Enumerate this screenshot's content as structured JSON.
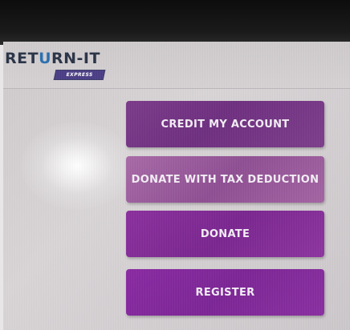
{
  "brand": {
    "logo_prefix": "RET",
    "logo_u": "U",
    "logo_suffix": "RN-IT",
    "badge": "EXPRESS",
    "colors": {
      "text": "#2a3346",
      "u_accent": "#2b6fae",
      "badge": "#4b3e86"
    }
  },
  "menu": {
    "credit_label": "CREDIT MY ACCOUNT",
    "donate_tax_label": "DONATE WITH TAX DEDUCTION",
    "donate_label": "DONATE",
    "register_label": "REGISTER"
  },
  "colors": {
    "button_purple": "#7a2690",
    "button_light_purple": "#9a5c9c",
    "screen_bg": "#d4d0d2",
    "bezel": "#111111"
  }
}
